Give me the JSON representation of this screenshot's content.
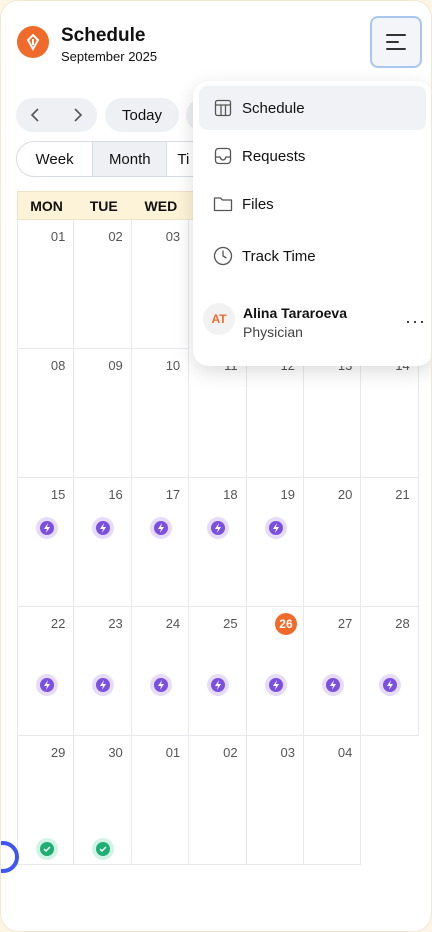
{
  "header": {
    "title": "Schedule",
    "subtitle": "September 2025"
  },
  "toolbar": {
    "today_label": "Today"
  },
  "views": {
    "week": "Week",
    "month": "Month",
    "time_partial": "Ti"
  },
  "calendar": {
    "weekday_headers": [
      "MON",
      "TUE",
      "WED"
    ],
    "weeks": [
      [
        {
          "day": "01"
        },
        {
          "day": "02"
        },
        {
          "day": "03"
        }
      ],
      [
        {
          "day": "08"
        },
        {
          "day": "09"
        },
        {
          "day": "10"
        },
        {
          "day": "11"
        },
        {
          "day": "12"
        },
        {
          "day": "13"
        },
        {
          "day": "14"
        }
      ],
      [
        {
          "day": "15",
          "event": "bolt"
        },
        {
          "day": "16",
          "event": "bolt"
        },
        {
          "day": "17",
          "event": "bolt"
        },
        {
          "day": "18",
          "event": "bolt"
        },
        {
          "day": "19",
          "event": "bolt"
        },
        {
          "day": "20"
        },
        {
          "day": "21"
        }
      ],
      [
        {
          "day": "22",
          "event": "bolt"
        },
        {
          "day": "23",
          "event": "bolt"
        },
        {
          "day": "24",
          "event": "bolt"
        },
        {
          "day": "25",
          "event": "bolt"
        },
        {
          "day": "26",
          "event": "bolt",
          "today": true
        },
        {
          "day": "27",
          "event": "bolt"
        },
        {
          "day": "28",
          "event": "bolt"
        }
      ],
      [
        {
          "day": "29",
          "event": "check"
        },
        {
          "day": "30",
          "event": "check"
        },
        {
          "day": "01"
        },
        {
          "day": "02"
        },
        {
          "day": "03"
        },
        {
          "day": "04"
        }
      ]
    ]
  },
  "menu": {
    "items": [
      {
        "label": "Schedule",
        "icon": "schedule-layout-icon",
        "active": true
      },
      {
        "label": "Requests",
        "icon": "inbox-tray-icon"
      },
      {
        "label": "Files",
        "icon": "folder-icon"
      },
      {
        "label": "Track Time",
        "icon": "clock-icon"
      }
    ],
    "user": {
      "initials": "AT",
      "name": "Alina Tararoeva",
      "role": "Physician",
      "more_label": "···"
    }
  },
  "colors": {
    "accent": "#ef6a2b",
    "event_purple": "#7b4fe0",
    "event_green": "#1fae74",
    "header_cream": "#fdf3d8",
    "focus_blue": "#a9c7ee"
  }
}
